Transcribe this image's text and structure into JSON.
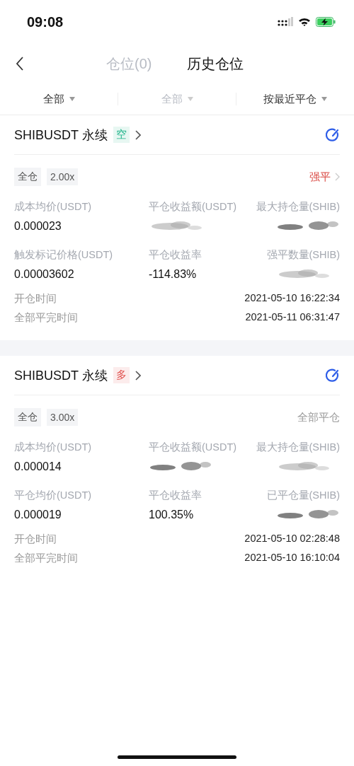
{
  "status_bar": {
    "time": "09:08"
  },
  "header": {
    "tabs": [
      {
        "label": "仓位(0)",
        "selected": false
      },
      {
        "label": "历史仓位",
        "selected": true
      }
    ]
  },
  "filters": [
    {
      "label": "全部",
      "disabled": false
    },
    {
      "label": "全部",
      "disabled": true
    },
    {
      "label": "按最近平仓",
      "disabled": false
    }
  ],
  "positions": [
    {
      "symbol": "SHIBUSDT 永续",
      "color": "#21b58b",
      "side_label": "空",
      "margin_mode": "全仓",
      "leverage": "2.00x",
      "status": {
        "kind": "liquidation",
        "label": "强平"
      },
      "fields": [
        {
          "label": "成本均价(USDT)",
          "kind": "text",
          "value": "0.000023"
        },
        {
          "label": "平仓收益额(USDT)",
          "kind": "redacted"
        },
        {
          "label": "最大持仓量(SHIB)",
          "kind": "redacted"
        },
        {
          "label": "触发标记价格(USDT)",
          "kind": "text",
          "value": "0.00003602"
        },
        {
          "label": "平仓收益率",
          "kind": "text",
          "value": "-114.83%"
        },
        {
          "label": "强平数量(SHIB)",
          "kind": "redacted"
        }
      ],
      "times": [
        {
          "label": "开仓时间",
          "value": "2021-05-10 16:22:34"
        },
        {
          "label": "全部平完时间",
          "value": "2021-05-11 06:31:47"
        }
      ]
    },
    {
      "symbol": "SHIBUSDT 永续",
      "color": "#e0524f",
      "side_label": "多",
      "margin_mode": "全仓",
      "leverage": "3.00x",
      "status": {
        "kind": "closed",
        "label": "全部平仓"
      },
      "fields": [
        {
          "label": "成本均价(USDT)",
          "kind": "text",
          "value": "0.000014"
        },
        {
          "label": "平仓收益额(USDT)",
          "kind": "redacted"
        },
        {
          "label": "最大持仓量(SHIB)",
          "kind": "redacted"
        },
        {
          "label": "平仓均价(USDT)",
          "kind": "text",
          "value": "0.000019"
        },
        {
          "label": "平仓收益率",
          "kind": "text",
          "value": "100.35%"
        },
        {
          "label": "已平仓量(SHIB)",
          "kind": "redacted"
        }
      ],
      "times": [
        {
          "label": "开仓时间",
          "value": "2021-05-10 02:28:48"
        },
        {
          "label": "全部平完时间",
          "value": "2021-05-10 16:10:04"
        }
      ]
    }
  ]
}
